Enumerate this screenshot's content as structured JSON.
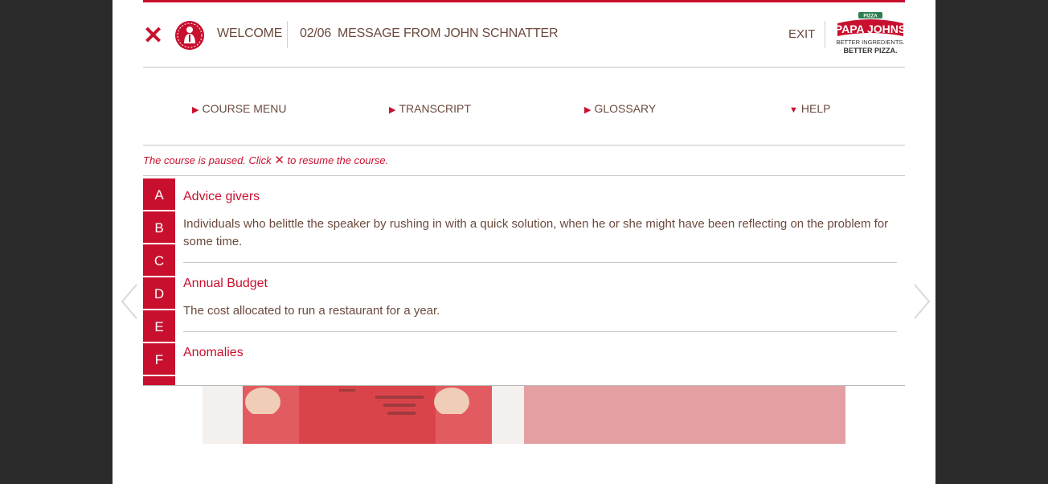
{
  "header": {
    "welcome": "WELCOME",
    "page_num": "02/06",
    "page_title": "MESSAGE FROM JOHN SCHNATTER",
    "exit": "EXIT",
    "logo_line1": "PAPA JOHNS",
    "logo_tag1": "BETTER INGREDIENTS.",
    "logo_tag2": "BETTER PIZZA.",
    "logo_pizza": "PIZZA"
  },
  "nav": {
    "course_menu": "COURSE MENU",
    "transcript": "TRANSCRIPT",
    "glossary": "GLOSSARY",
    "help": "HELP"
  },
  "pause": {
    "before": "The course is paused. Click",
    "after": "to resume the course."
  },
  "glossary": {
    "letters": [
      "A",
      "B",
      "C",
      "D",
      "E",
      "F"
    ],
    "entries": [
      {
        "term": "Advice givers",
        "definition": "Individuals who belittle the speaker by rushing in with a quick solution, when he or she might have been reflecting on the problem for some time."
      },
      {
        "term": "Annual Budget",
        "definition": "The cost allocated to run a restaurant for a year."
      },
      {
        "term": "Anomalies",
        "definition": ""
      }
    ]
  },
  "colors": {
    "accent": "#c8102e",
    "text": "#6b4a3d",
    "pink_panel": "#e39fa1",
    "backdrop": "#2b2b2b"
  },
  "icons": {
    "close": "close-icon",
    "avatar": "founder-avatar-icon",
    "prev": "chevron-left-icon",
    "next": "chevron-right-icon"
  }
}
